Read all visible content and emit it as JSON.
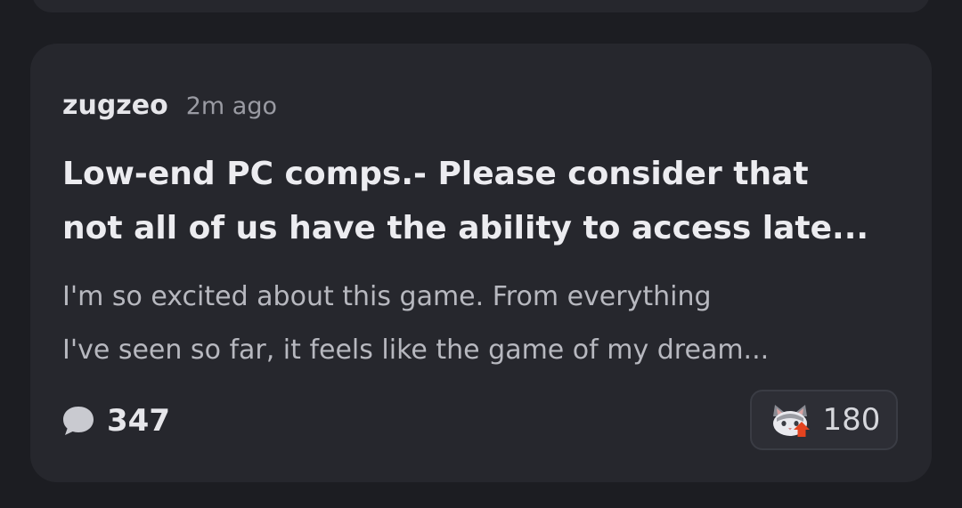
{
  "post": {
    "author": "zugzeo",
    "time": "2m ago",
    "title_lines": [
      "Low-end PC comps.- Please consider that",
      "not all of us have the ability to access late..."
    ],
    "excerpt_lines": [
      "I'm so excited about this game. From everything",
      "I've seen so far, it feels like the game of my dream..."
    ],
    "comment_count": "347",
    "upvote_count": "180"
  },
  "icons": {
    "comments": "speech-bubble-icon",
    "upvote": "cat-upvote-icon"
  },
  "colors": {
    "background": "#1c1d22",
    "card": "#26272d",
    "upvote_arrow": "#e4431f"
  }
}
